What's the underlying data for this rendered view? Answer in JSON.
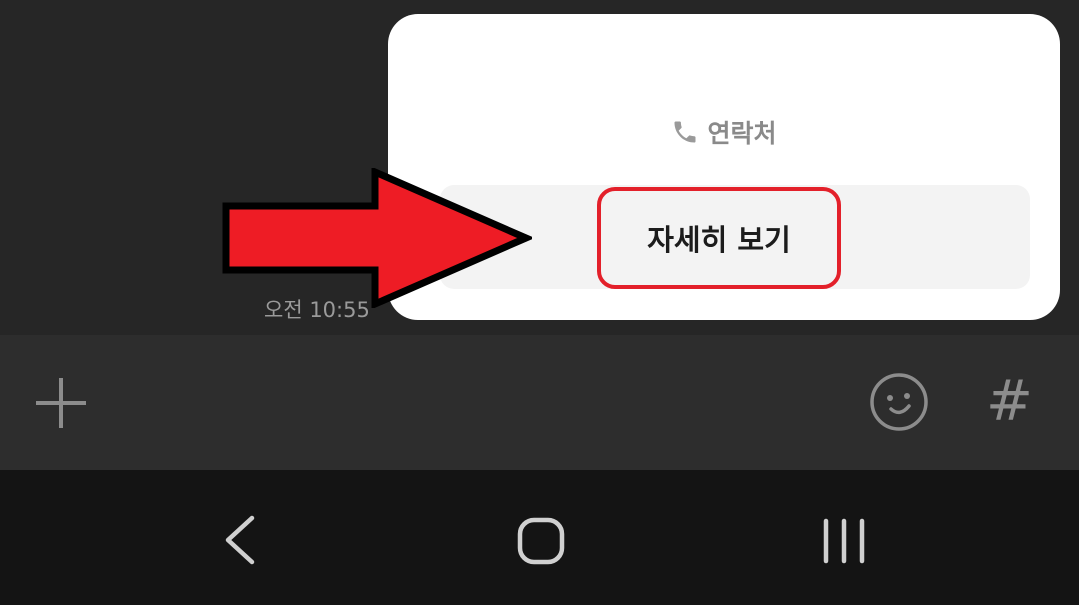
{
  "chat": {
    "timestamp": "오전 10:55"
  },
  "popup": {
    "contact_label": "연락처",
    "detail_label": "자세히 보기",
    "highlight_color": "#e3202a"
  },
  "annotation": {
    "arrow_color": "#ee1c25",
    "arrow_icon": "right-arrow-icon"
  },
  "input_bar": {
    "plus_icon": "plus-icon",
    "emoji_icon": "smiley-icon",
    "hashtag_label": "#"
  },
  "nav_bar": {
    "icons": [
      "back-icon",
      "home-icon",
      "recent-apps-icon"
    ]
  }
}
